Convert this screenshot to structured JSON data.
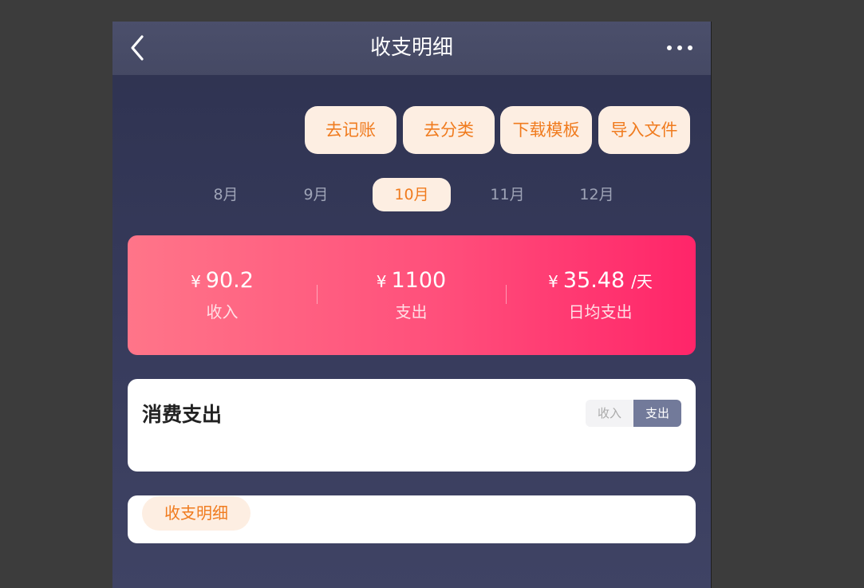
{
  "header": {
    "title": "收支明细"
  },
  "actions": [
    "去记账",
    "去分类",
    "下载模板",
    "导入文件"
  ],
  "months": [
    {
      "label": "8月",
      "active": false
    },
    {
      "label": "9月",
      "active": false
    },
    {
      "label": "10月",
      "active": true
    },
    {
      "label": "11月",
      "active": false
    },
    {
      "label": "12月",
      "active": false
    }
  ],
  "summary": {
    "currency": "¥",
    "income": {
      "value": "90.2",
      "label": "收入"
    },
    "expense": {
      "value": "1100",
      "label": "支出"
    },
    "daily": {
      "value": "35.48",
      "unit": "/天",
      "label": "日均支出"
    }
  },
  "consumption": {
    "title": "消费支出",
    "toggle": {
      "income": "收入",
      "expense": "支出",
      "selected": "支出"
    }
  },
  "details": {
    "tag": "收支明细"
  },
  "colors": {
    "accent": "#f07b1e",
    "pink": "#ff4f7b",
    "nav": "#4b4f6b",
    "toggle_active": "#727a9a"
  }
}
